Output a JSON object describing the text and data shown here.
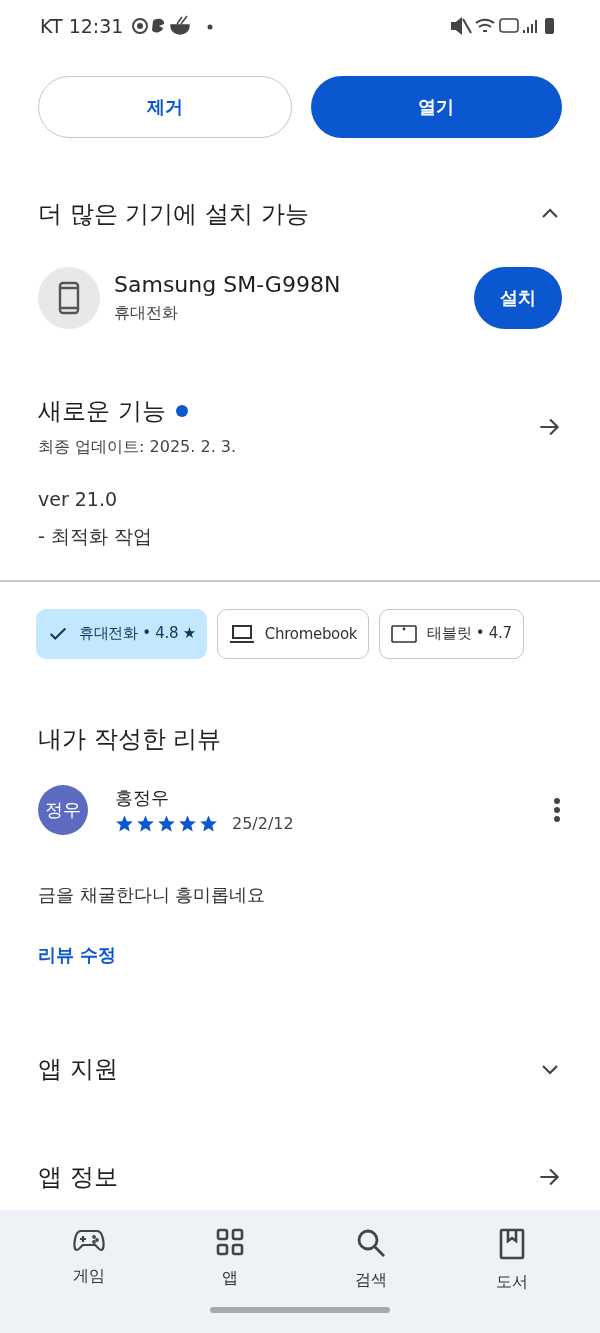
{
  "status_bar": {
    "carrier_time": "KT 12:31"
  },
  "actions": [
    {
      "label": "제거",
      "kind": "outline"
    },
    {
      "label": "열기",
      "kind": "filled"
    }
  ],
  "devices_section": {
    "title": "더 많은 기기에 설치 가능",
    "expanded": true,
    "device": {
      "name": "Samsung SM-G998N",
      "type": "휴대전화",
      "button": "설치"
    }
  },
  "whats_new": {
    "title": "새로운 기능",
    "new": true,
    "updated": "최종 업데이트: 2025. 2. 3.",
    "lines": [
      "ver 21.0",
      "- 최적화 작업"
    ]
  },
  "chips": [
    {
      "label": "휴대전화 • 4.8 ★",
      "kind": "check",
      "selected": true
    },
    {
      "label": "Chromebook",
      "kind": "laptop",
      "selected": false
    },
    {
      "label": "태블릿 • 4.7",
      "kind": "tablet",
      "selected": false
    }
  ],
  "my_review": {
    "title": "내가 작성한 리뷰",
    "avatar": "정우",
    "author": "홍정우",
    "stars": 5,
    "date": "25/2/12",
    "text": "금을 채굴한다니 흥미롭네요",
    "edit_link": "리뷰 수정"
  },
  "sections": [
    {
      "title": "앱 지원",
      "kind": "expand",
      "expanded": false
    },
    {
      "title": "앱 정보",
      "kind": "link"
    }
  ],
  "bottom_nav": [
    {
      "label": "게임",
      "kind": "games"
    },
    {
      "label": "앱",
      "kind": "apps"
    },
    {
      "label": "검색",
      "kind": "search"
    },
    {
      "label": "도서",
      "kind": "books"
    }
  ]
}
